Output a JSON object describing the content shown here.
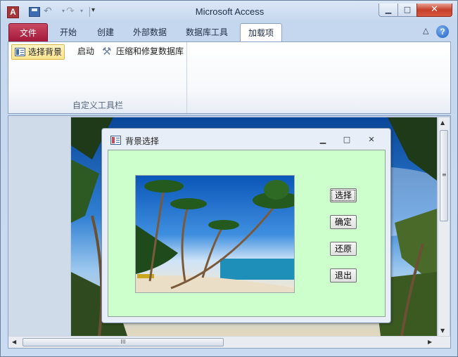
{
  "window": {
    "title": "Microsoft Access",
    "app_icon_letter": "A",
    "minimize_glyph": "▭",
    "maximize_glyph": "□",
    "close_glyph": "✕"
  },
  "ribbon_tabs": {
    "file": "文件",
    "home": "开始",
    "create": "创建",
    "external": "外部数据",
    "dbtools": "数据库工具",
    "addins": "加载项"
  },
  "ribbon": {
    "select_background": "选择背景",
    "start": "启动",
    "compact_repair": "压缩和修复数据库",
    "group_label": "自定义工具栏"
  },
  "help": {
    "collapse_glyph": "△",
    "help_glyph": "?"
  },
  "scrollbars": {
    "hthumb_grip": "III",
    "vthumb_grip": "≡"
  },
  "dialog": {
    "title": "背景选择",
    "buttons": {
      "select": "选择",
      "confirm": "确定",
      "restore": "还原",
      "exit": "退出"
    }
  },
  "colors": {
    "file_tab": "#a4173a",
    "dialog_body": "#ccffcc",
    "accent": "#fbe38e"
  }
}
